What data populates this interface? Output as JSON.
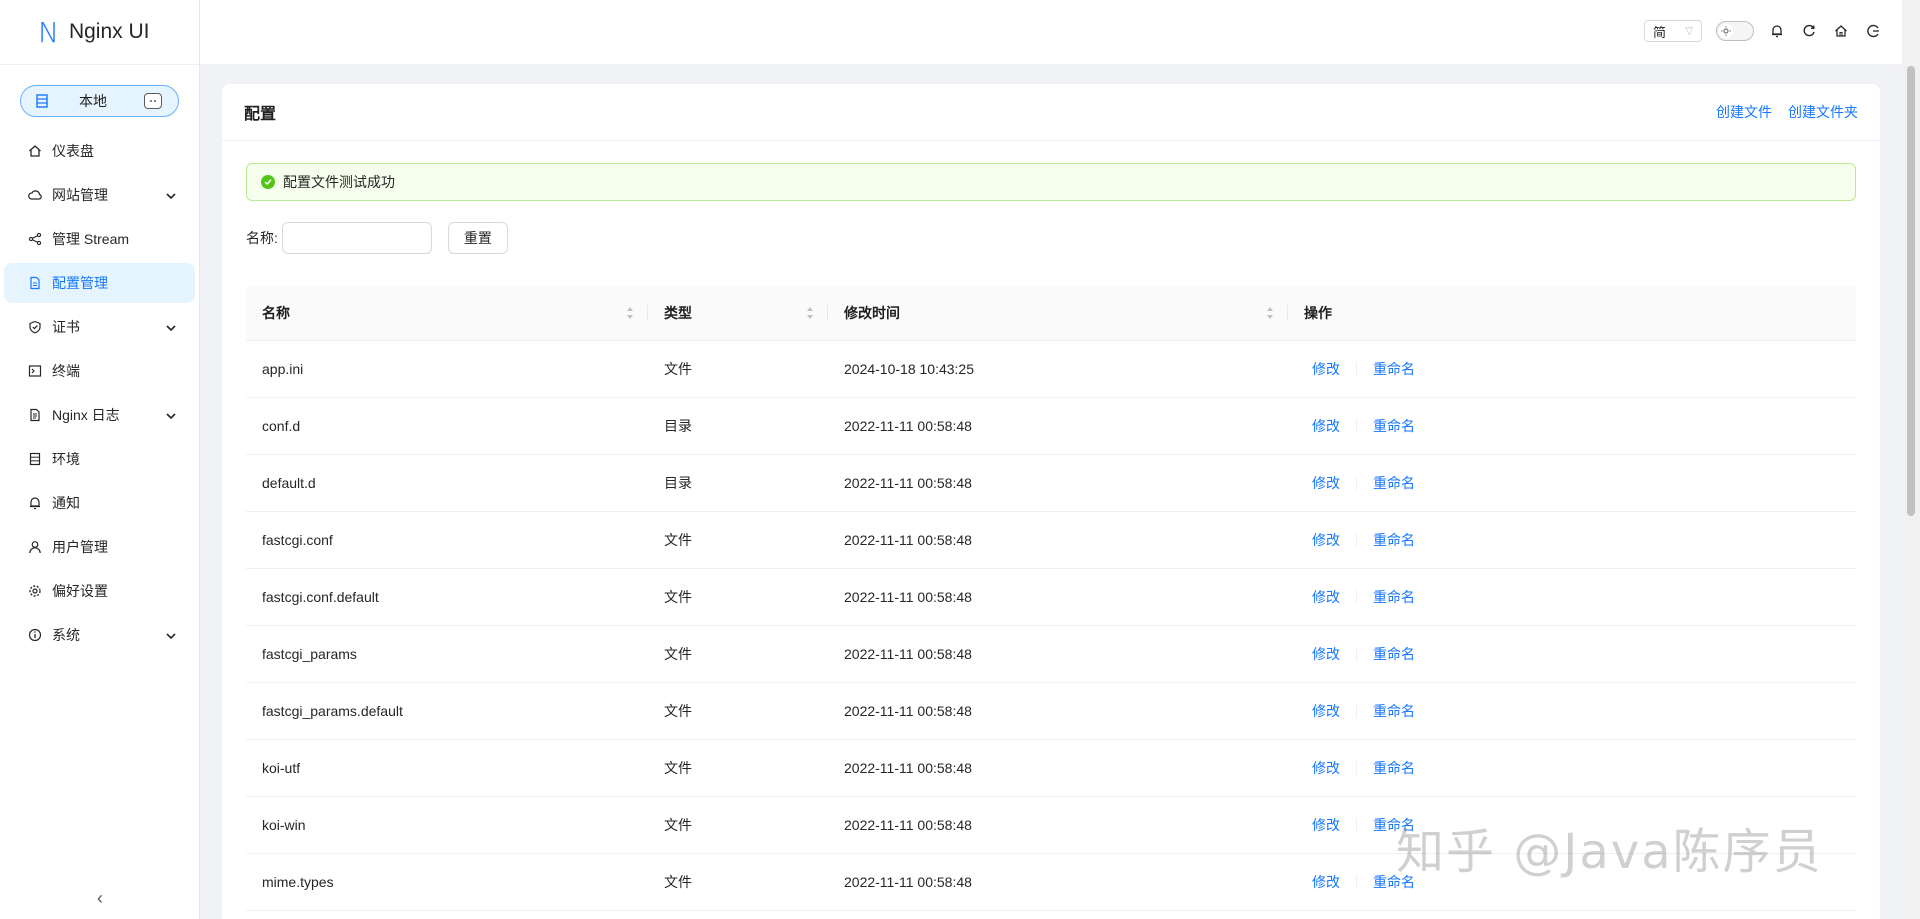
{
  "app": {
    "logo_letter": "N",
    "title": "Nginx UI"
  },
  "env": {
    "label": "本地"
  },
  "menu": [
    {
      "label": "仪表盘",
      "icon": "home-icon",
      "expand": false
    },
    {
      "label": "网站管理",
      "icon": "cloud-icon",
      "expand": true
    },
    {
      "label": "管理 Stream",
      "icon": "share-icon",
      "expand": false
    },
    {
      "label": "配置管理",
      "icon": "file-icon",
      "expand": false,
      "active": true
    },
    {
      "label": "证书",
      "icon": "shield-icon",
      "expand": true
    },
    {
      "label": "终端",
      "icon": "terminal-icon",
      "expand": false
    },
    {
      "label": "Nginx 日志",
      "icon": "log-icon",
      "expand": true
    },
    {
      "label": "环境",
      "icon": "database-icon",
      "expand": false
    },
    {
      "label": "通知",
      "icon": "bell-icon",
      "expand": false
    },
    {
      "label": "用户管理",
      "icon": "user-icon",
      "expand": false
    },
    {
      "label": "偏好设置",
      "icon": "gear-icon",
      "expand": false
    },
    {
      "label": "系统",
      "icon": "info-icon",
      "expand": true
    }
  ],
  "header": {
    "lang": "简"
  },
  "page": {
    "title": "配置",
    "create_file": "创建文件",
    "create_folder": "创建文件夹",
    "alert": "配置文件测试成功",
    "search_label": "名称:",
    "search_value": "",
    "reset": "重置"
  },
  "table": {
    "columns": [
      "名称",
      "类型",
      "修改时间",
      "操作"
    ],
    "rows": [
      {
        "name": "app.ini",
        "type": "文件",
        "time": "2024-10-18 10:43:25"
      },
      {
        "name": "conf.d",
        "type": "目录",
        "time": "2022-11-11 00:58:48"
      },
      {
        "name": "default.d",
        "type": "目录",
        "time": "2022-11-11 00:58:48"
      },
      {
        "name": "fastcgi.conf",
        "type": "文件",
        "time": "2022-11-11 00:58:48"
      },
      {
        "name": "fastcgi.conf.default",
        "type": "文件",
        "time": "2022-11-11 00:58:48"
      },
      {
        "name": "fastcgi_params",
        "type": "文件",
        "time": "2022-11-11 00:58:48"
      },
      {
        "name": "fastcgi_params.default",
        "type": "文件",
        "time": "2022-11-11 00:58:48"
      },
      {
        "name": "koi-utf",
        "type": "文件",
        "time": "2022-11-11 00:58:48"
      },
      {
        "name": "koi-win",
        "type": "文件",
        "time": "2022-11-11 00:58:48"
      },
      {
        "name": "mime.types",
        "type": "文件",
        "time": "2022-11-11 00:58:48"
      }
    ],
    "action_edit": "修改",
    "action_rename": "重命名"
  },
  "watermark": "知乎 @Java陈序员",
  "colors": {
    "primary": "#1677ff",
    "success": "#52c41a",
    "active_bg": "#e6f4ff"
  }
}
